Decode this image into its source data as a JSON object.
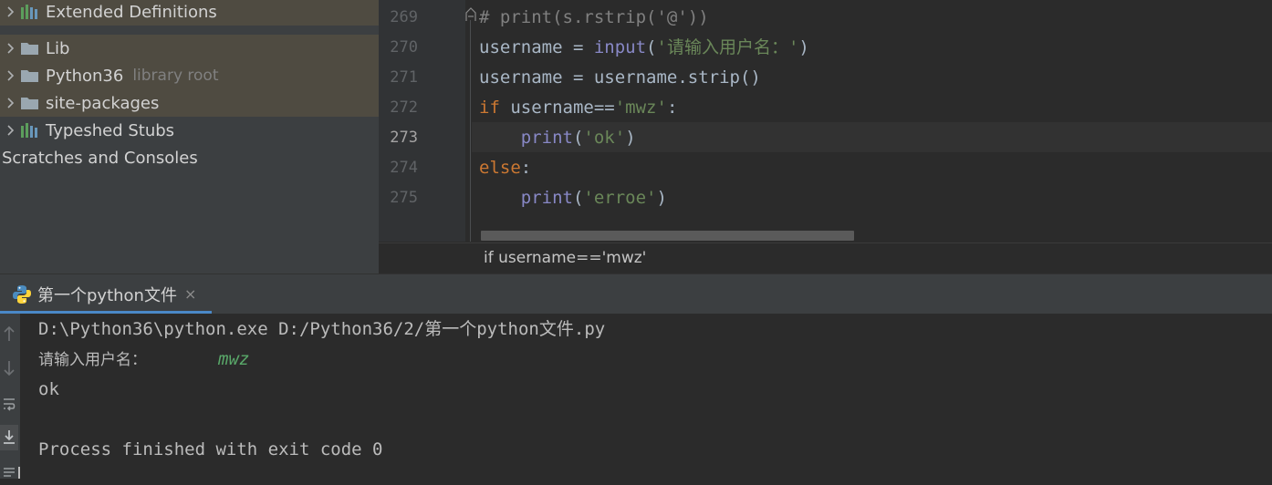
{
  "project_tree": {
    "items": [
      {
        "label": "Extended Definitions",
        "hint": "",
        "icon": "library-icon",
        "expandable": true
      },
      {
        "label": "Lib",
        "hint": "",
        "icon": "folder-icon",
        "expandable": true
      },
      {
        "label": "Python36",
        "hint": "library root",
        "icon": "folder-icon",
        "expandable": true
      },
      {
        "label": "site-packages",
        "hint": "",
        "icon": "folder-icon",
        "expandable": true
      },
      {
        "label": "Typeshed Stubs",
        "hint": "",
        "icon": "library-icon",
        "expandable": true
      },
      {
        "label": "Scratches and Consoles",
        "hint": "",
        "icon": "",
        "expandable": false
      }
    ],
    "selected_bg": "#4f4b41"
  },
  "editor": {
    "line_numbers": [
      "269",
      "270",
      "271",
      "272",
      "273",
      "274",
      "275"
    ],
    "current_line": "273",
    "code": {
      "l269": {
        "text": "# print(s.rstrip('@'))"
      },
      "l270": {
        "a": "username = ",
        "b": "input",
        "c": "(",
        "d": "'请输入用户名：'",
        "e": ")"
      },
      "l271": {
        "text": "username = username.strip()"
      },
      "l272": {
        "a": "if",
        "b": " username==",
        "c": "'mwz'",
        "d": ":"
      },
      "l273": {
        "indent": "    ",
        "a": "print",
        "b": "(",
        "c": "'ok'",
        "d": ")"
      },
      "l274": {
        "a": "else",
        "b": ":"
      },
      "l275": {
        "indent": "    ",
        "a": "print",
        "b": "(",
        "c": "'erroe'",
        "d": ")"
      }
    },
    "breadcrumb": "if username=='mwz'"
  },
  "run_panel": {
    "tab_label": "第一个python文件",
    "tab_close": "×",
    "console": {
      "command": "D:\\Python36\\python.exe D:/Python36/2/第一个python文件.py",
      "prompt": "请输入用户名：",
      "user_input": "mwz",
      "output": "ok",
      "exit_message": "Process finished with exit code 0"
    },
    "side_buttons": [
      "up-arrow-icon",
      "down-arrow-icon",
      "soft-wrap-icon",
      "scroll-to-end-icon",
      "print-icon"
    ]
  },
  "colors": {
    "keyword": "#cc7832",
    "string": "#6a8759",
    "builtin": "#8888c6",
    "comment": "#808080",
    "accent": "#4a88c7"
  }
}
